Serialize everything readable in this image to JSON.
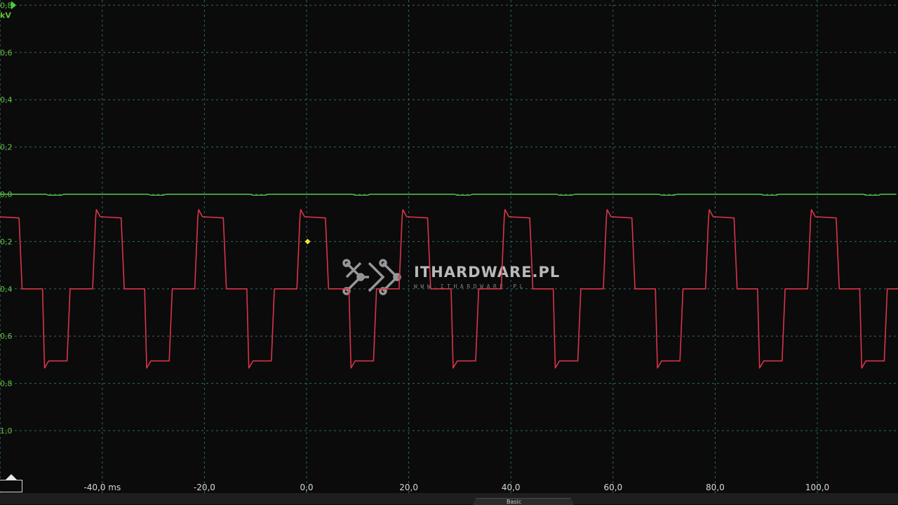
{
  "watermark": {
    "brand": "ITHARDWARE.PL",
    "url": "WWW.ITHARDWARE.PL"
  },
  "footer": {
    "tab_label": "Basic"
  },
  "colors": {
    "background": "#0b0b0b",
    "grid": "#2f6a66",
    "channel_b": "#56c94a",
    "channel_a": "#d9344a",
    "axis_label": "#62c13c",
    "marker": "#f2e23a"
  },
  "chart_data": {
    "type": "line",
    "title": "",
    "xlabel": "",
    "ylabel": "",
    "x_unit_label": "ms",
    "y_unit_label": "kV",
    "xlim": [
      -60.0,
      115.0
    ],
    "ylim": [
      1.2,
      -0.8
    ],
    "grid": true,
    "y_ticks": [
      {
        "value": -0.8,
        "label": "0,8"
      },
      {
        "value": -0.6,
        "label": "0,6"
      },
      {
        "value": -0.4,
        "label": "0,4"
      },
      {
        "value": -0.2,
        "label": "0,2"
      },
      {
        "value": 0.0,
        "label": "0,0"
      },
      {
        "value": 0.2,
        "label": "0,2"
      },
      {
        "value": 0.4,
        "label": "0,4"
      },
      {
        "value": 0.6,
        "label": "0,6"
      },
      {
        "value": 0.8,
        "label": "0,8"
      },
      {
        "value": 1.0,
        "label": "1,0"
      }
    ],
    "x_ticks": [
      {
        "value": -40.0,
        "label": "-40,0 ms"
      },
      {
        "value": -20.0,
        "label": "-20,0"
      },
      {
        "value": 0.0,
        "label": "0,0"
      },
      {
        "value": 20.0,
        "label": "20,0"
      },
      {
        "value": 40.0,
        "label": "40,0"
      },
      {
        "value": 60.0,
        "label": "60,0"
      },
      {
        "value": 80.0,
        "label": "80,0"
      },
      {
        "value": 100.0,
        "label": "100,0"
      }
    ],
    "extra_grid_x": [
      -60.0,
      120.0
    ],
    "series": [
      {
        "color": "#56c94a",
        "description_values": "flat trace around 0 kV",
        "period_ms": 20.0,
        "baseline": 0.0,
        "dip": 0.004
      },
      {
        "color": "#d9344a",
        "period_ms": 20.0,
        "phase_ms": -1.3,
        "cycle": [
          {
            "t": 0.0,
            "v": 0.1
          },
          {
            "t": 0.15,
            "v": 0.065
          },
          {
            "t": 0.9,
            "v": 0.095
          },
          {
            "t": 5.0,
            "v": 0.1
          },
          {
            "t": 5.6,
            "v": 0.4
          },
          {
            "t": 9.6,
            "v": 0.4
          },
          {
            "t": 10.0,
            "v": 0.735
          },
          {
            "t": 10.8,
            "v": 0.705
          },
          {
            "t": 14.4,
            "v": 0.705
          },
          {
            "t": 15.0,
            "v": 0.4
          },
          {
            "t": 19.4,
            "v": 0.4
          },
          {
            "t": 20.0,
            "v": 0.1
          }
        ]
      }
    ],
    "trigger_marker": {
      "t": 0.2,
      "v": 0.2
    },
    "unit_flag_value": -0.8
  }
}
